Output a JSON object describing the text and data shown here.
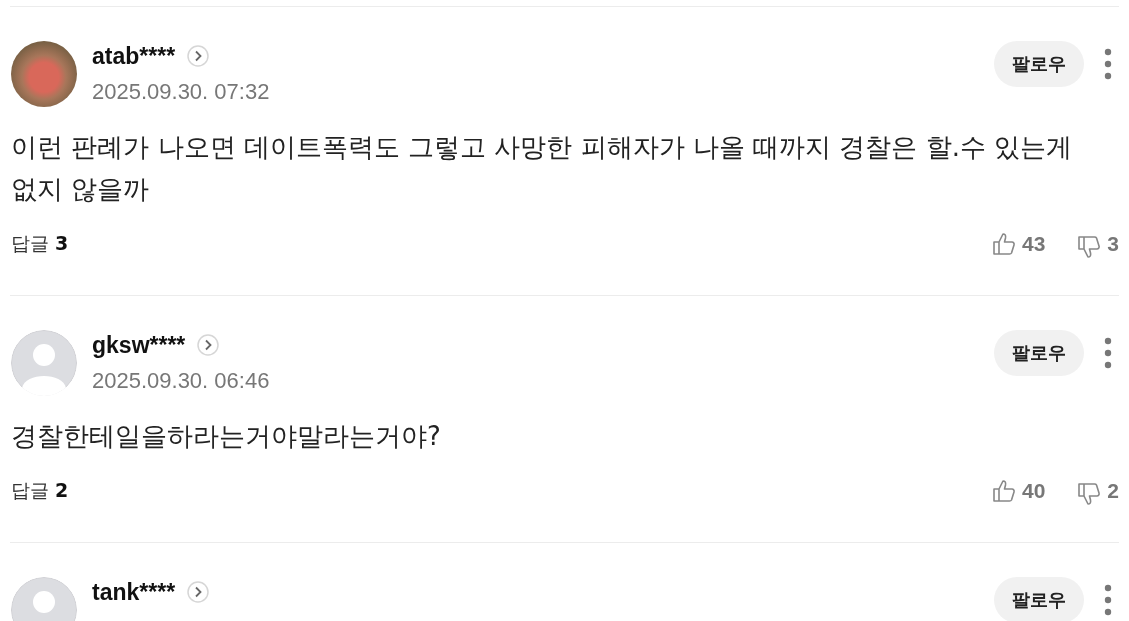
{
  "comments": [
    {
      "avatar": {
        "kind": "photo"
      },
      "username": "atab****",
      "date": "2025.09.30. 07:32",
      "follow": "팔로우",
      "text": "이런 판례가 나오면 데이트폭력도 그렇고 사망한 피해자가 나올 때까지 경찰은 할.수 있는게 없지 않을까",
      "replies": "답글 **3**",
      "likes": "43",
      "dislikes": "3"
    },
    {
      "avatar": {
        "kind": "default"
      },
      "username": "gksw****",
      "date": "2025.09.30. 06:46",
      "follow": "팔로우",
      "text": "경찰한테일을하라는거야말라는거야?",
      "replies": "답글 **2**",
      "likes": "40",
      "dislikes": "2"
    },
    {
      "avatar": {
        "kind": "default"
      },
      "username": "tank****",
      "follow": "팔로우"
    }
  ]
}
